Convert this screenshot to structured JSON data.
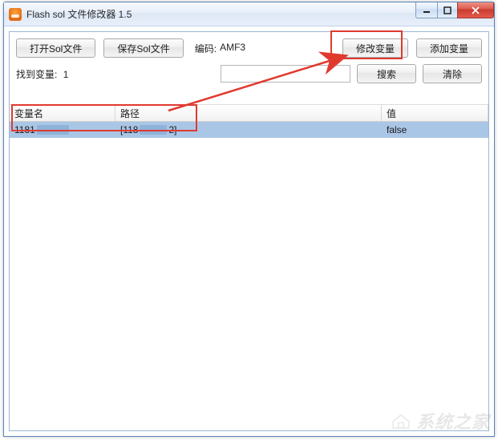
{
  "window": {
    "title": "Flash sol 文件修改器 1.5"
  },
  "toolbar": {
    "open_label": "打开Sol文件",
    "save_label": "保存Sol文件",
    "encoding_label": "编码:",
    "encoding_value": "AMF3",
    "modify_label": "修改变量",
    "add_label": "添加变量"
  },
  "searchbar": {
    "found_label": "找到变量:",
    "found_count": "1",
    "search_label": "搜索",
    "clear_label": "清除",
    "search_value": ""
  },
  "grid": {
    "columns": {
      "name": "变量名",
      "path": "路径",
      "value": "值"
    },
    "rows": [
      {
        "name_prefix": "1181",
        "path_prefix": "[118",
        "path_suffix": "2]",
        "value": "false"
      }
    ]
  },
  "watermark": "系统之家"
}
